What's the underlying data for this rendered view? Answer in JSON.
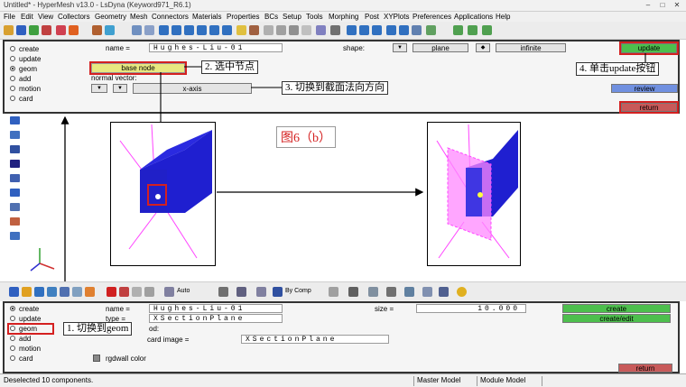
{
  "window": {
    "title": "Untitled* - HyperMesh v13.0 - LsDyna (Keyword971_R6.1)",
    "controls": [
      "–",
      "□",
      "✕"
    ]
  },
  "menu": [
    "File",
    "Edit",
    "View",
    "Collectors",
    "Geometry",
    "Mesh",
    "Connectors",
    "Materials",
    "Properties",
    "BCs",
    "Setup",
    "Tools",
    "Morphing",
    "Post",
    "XYPlots",
    "Preferences",
    "Applications",
    "Help"
  ],
  "top_panel": {
    "radios": [
      "create",
      "update",
      "geom",
      "add",
      "motion",
      "card"
    ],
    "selected_radio": "geom",
    "name_label": "name =",
    "name_value": "Hughes-Liu-01",
    "shape_label": "shape:",
    "shape_value": "plane",
    "infinite_label": "infinite",
    "base_node_label": "base node",
    "normal_vector_label": "normal vector:",
    "axis_value": "x-axis",
    "update_button": "update",
    "review_button": "review",
    "return_button": "return"
  },
  "callouts": {
    "c1": "1. 切换到geom",
    "c2": "2. 选中节点",
    "c3": "3. 切换到截面法向方向",
    "c4": "4. 单击update按钮"
  },
  "figure_caption": "图6（b）",
  "bottom_toolbar": {
    "auto_label": "Auto",
    "bycomp_label": "By Comp"
  },
  "bottom_panel": {
    "radios": [
      "create",
      "update",
      "geom",
      "add",
      "motion",
      "card"
    ],
    "selected_radio": "create",
    "name_label": "name =",
    "name_value": "Hughes-Liu-01",
    "type_label": "type =",
    "type_value": "XSectionPlane",
    "method_label": "od:",
    "card_image_label": "card image =",
    "card_image_value": "XSectionPlane",
    "color_label": "rgdwall color",
    "size_label": "size =",
    "size_value": "10.000",
    "create_button": "create",
    "create_edit_button": "create/edit",
    "return_button": "return"
  },
  "status": {
    "message": "Deselected 10 components.",
    "model_label": "Master Model",
    "module_label": "Module Model"
  },
  "colors": {
    "accent_green": "#4dbf4d",
    "callout_red": "#d42020",
    "cube_blue": "#1f1fd0",
    "plane_magenta": "#ff66ff"
  }
}
